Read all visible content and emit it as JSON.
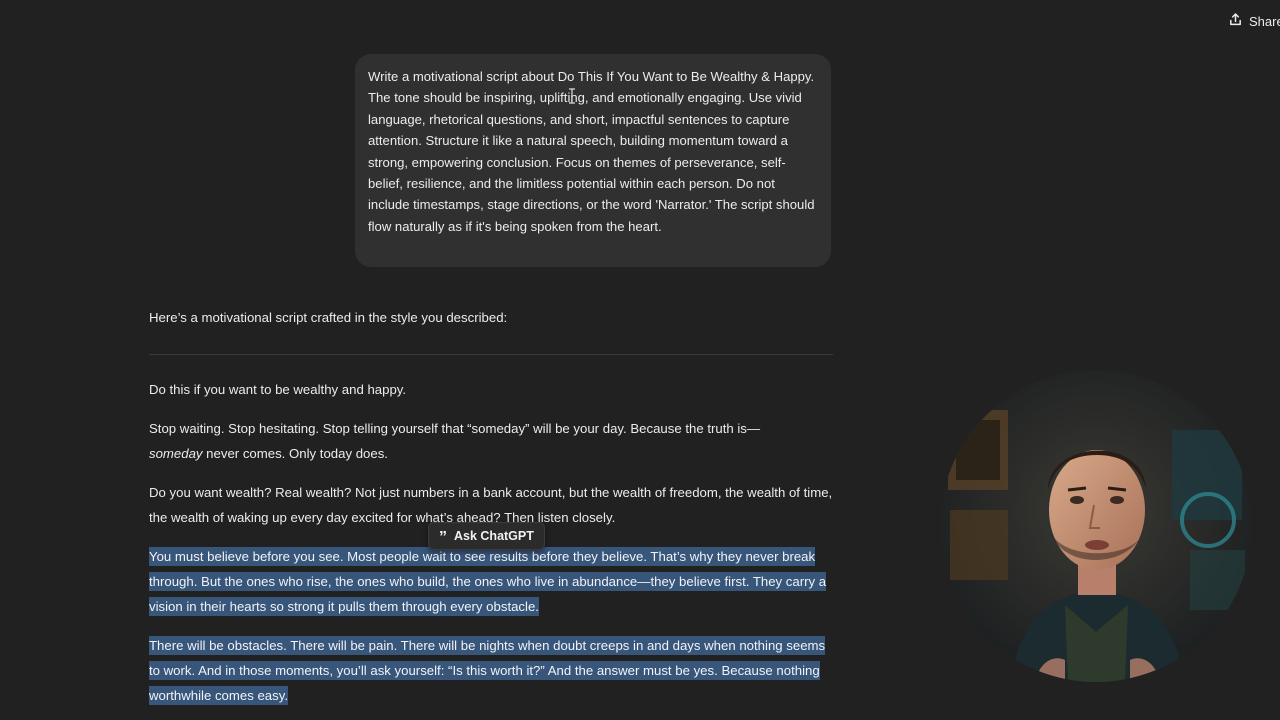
{
  "header": {
    "share_label": "Share"
  },
  "user_message": {
    "text": "Write a motivational script about Do This If You Want to Be Wealthy & Happy. The tone should be inspiring, uplifting, and emotionally engaging. Use vivid language, rhetorical questions, and short, impactful sentences to capture attention. Structure it like a natural speech, building momentum toward a strong, empowering conclusion. Focus on themes of perseverance, self-belief, resilience, and the limitless potential within each person. Do not include timestamps, stage directions, or the word 'Narrator.' The script should flow naturally as if it's being spoken from the heart."
  },
  "assistant_message": {
    "intro": "Here’s a motivational script crafted in the style you described:",
    "paragraphs": {
      "p1": "Do this if you want to be wealthy and happy.",
      "p2_a": "Stop waiting. Stop hesitating. Stop telling yourself that “someday” will be your day. Because the truth is—",
      "p2_em": "someday",
      "p2_b": " never comes. Only today does.",
      "p3": "Do you want wealth? Real wealth? Not just numbers in a bank account, but the wealth of freedom, the wealth of time, the wealth of waking up every day excited for what’s ahead? Then listen closely.",
      "p4": "You must believe before you see. Most people wait to see results before they believe. That’s why they never break through. But the ones who rise, the ones who build, the ones who live in abundance—they believe first. They carry a vision in their hearts so strong it pulls them through every obstacle.",
      "p5": "There will be obstacles. There will be pain. There will be nights when doubt creeps in and days when nothing seems to work. And in those moments, you’ll ask yourself: “Is this worth it?” And the answer must be yes. Because nothing worthwhile comes easy."
    }
  },
  "popover": {
    "ask_label": "Ask ChatGPT",
    "icon": "quote-icon"
  },
  "webcam": {
    "icon": "presenter-avatar"
  },
  "colors": {
    "background": "#212121",
    "bubble": "#303030",
    "selection": "#38557a",
    "text": "#ececec"
  }
}
